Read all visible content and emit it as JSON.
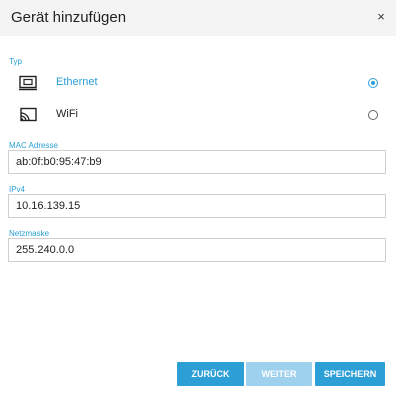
{
  "dialog": {
    "title": "Gerät hinzufügen",
    "close_glyph": "×"
  },
  "type_section": {
    "label": "Typ",
    "options": [
      {
        "label": "Ethernet",
        "icon": "ethernet-icon",
        "selected": true
      },
      {
        "label": "WiFi",
        "icon": "wifi-icon",
        "selected": false
      }
    ]
  },
  "fields": {
    "mac": {
      "label": "MAC Adresse",
      "value": "ab:0f:b0:95:47:b9"
    },
    "ipv4": {
      "label": "IPv4",
      "value": "10.16.139.15"
    },
    "netmask": {
      "label": "Netzmaske",
      "value": "255.240.0.0"
    }
  },
  "buttons": {
    "back": "ZURÜCK",
    "next": "WEITER",
    "save": "SPEICHERN"
  },
  "colors": {
    "accent": "#2b9fd6",
    "accent_disabled": "#9ed1ee",
    "header_bg": "#f4f4f4"
  }
}
